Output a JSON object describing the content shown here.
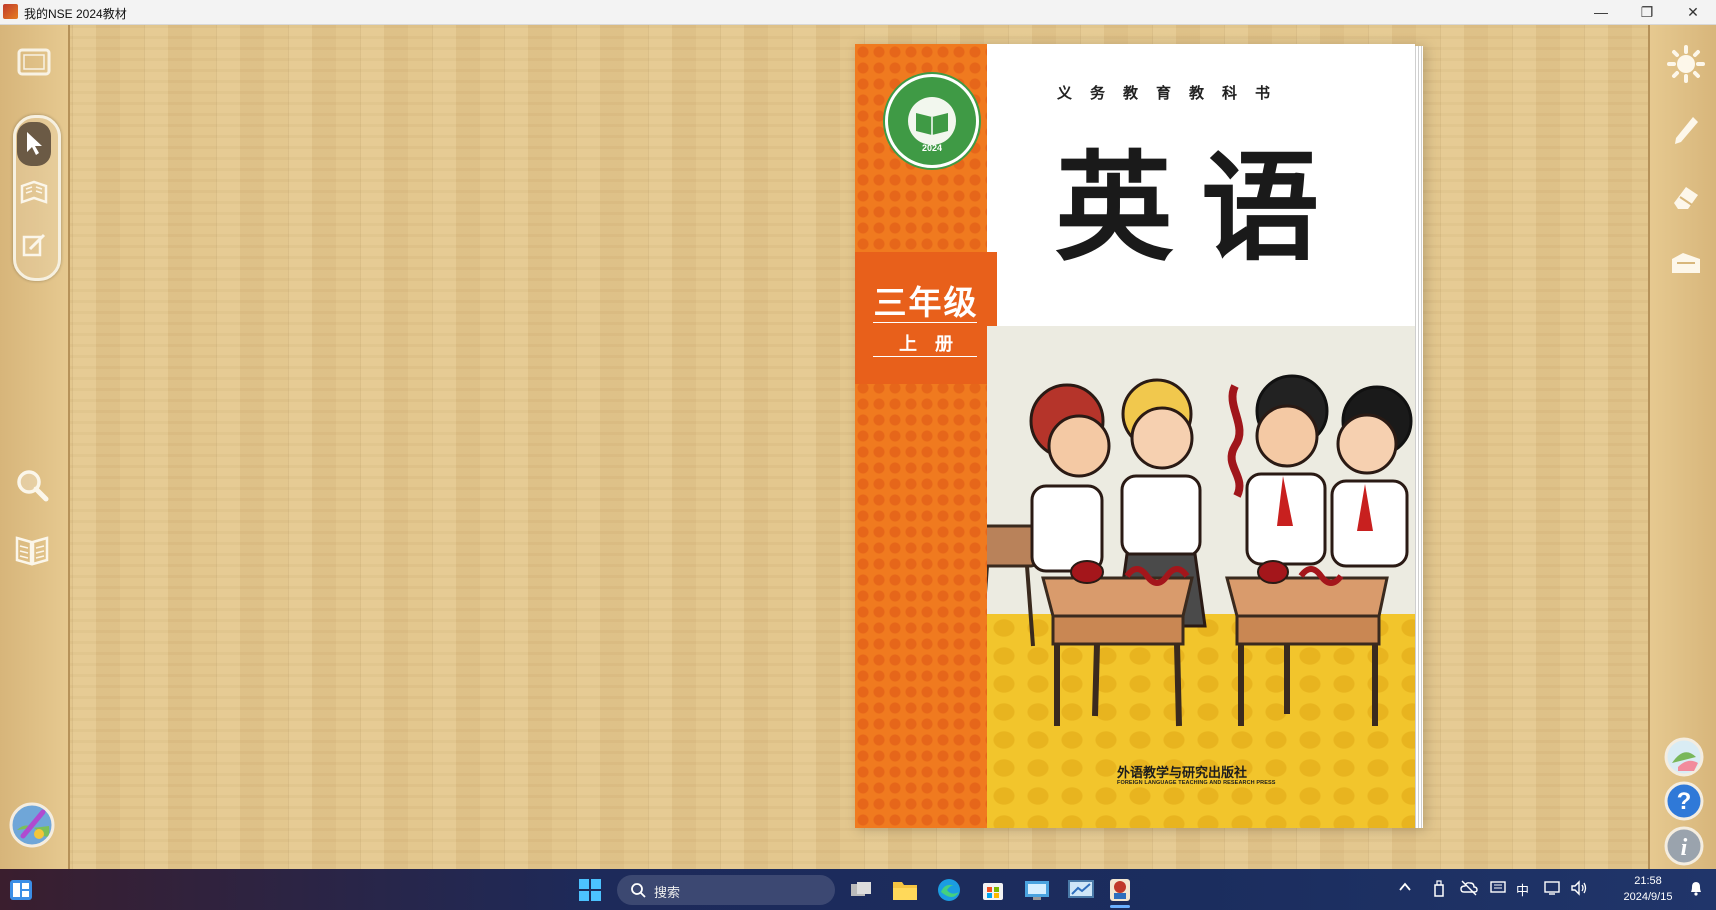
{
  "window": {
    "title": "我的NSE 2024教材",
    "minimize": "—",
    "maximize": "❐",
    "close": "✕"
  },
  "left_toolbar": [
    {
      "name": "fullscreen-icon"
    },
    {
      "name": "pointer-icon"
    },
    {
      "name": "book-pages-icon"
    },
    {
      "name": "annotate-icon"
    },
    {
      "name": "magnifier-icon"
    },
    {
      "name": "page-list-icon"
    },
    {
      "name": "resource-globe-icon"
    }
  ],
  "right_toolbar": [
    {
      "name": "spotlight-icon"
    },
    {
      "name": "pen-icon"
    },
    {
      "name": "eraser-icon"
    },
    {
      "name": "clear-icon"
    },
    {
      "name": "cloud-resource-icon"
    },
    {
      "name": "help-icon"
    },
    {
      "name": "info-icon"
    }
  ],
  "book": {
    "series": "义务教育教科书",
    "subject": "英语",
    "grade": "三年级",
    "volume": "上册",
    "seal_year": "2024",
    "publisher": "外语教学与研究出版社",
    "publisher_en": "FOREIGN LANGUAGE TEACHING AND RESEARCH PRESS"
  },
  "taskbar": {
    "search_placeholder": "搜索",
    "ime": "中",
    "time": "21:58",
    "date": "2024/9/15"
  },
  "colors": {
    "cover_orange": "#f07a1f",
    "grade_orange": "#e8601b",
    "seal_green": "#3f9a45",
    "floor_yellow": "#f2c52c",
    "wood": "#e3c78e"
  }
}
